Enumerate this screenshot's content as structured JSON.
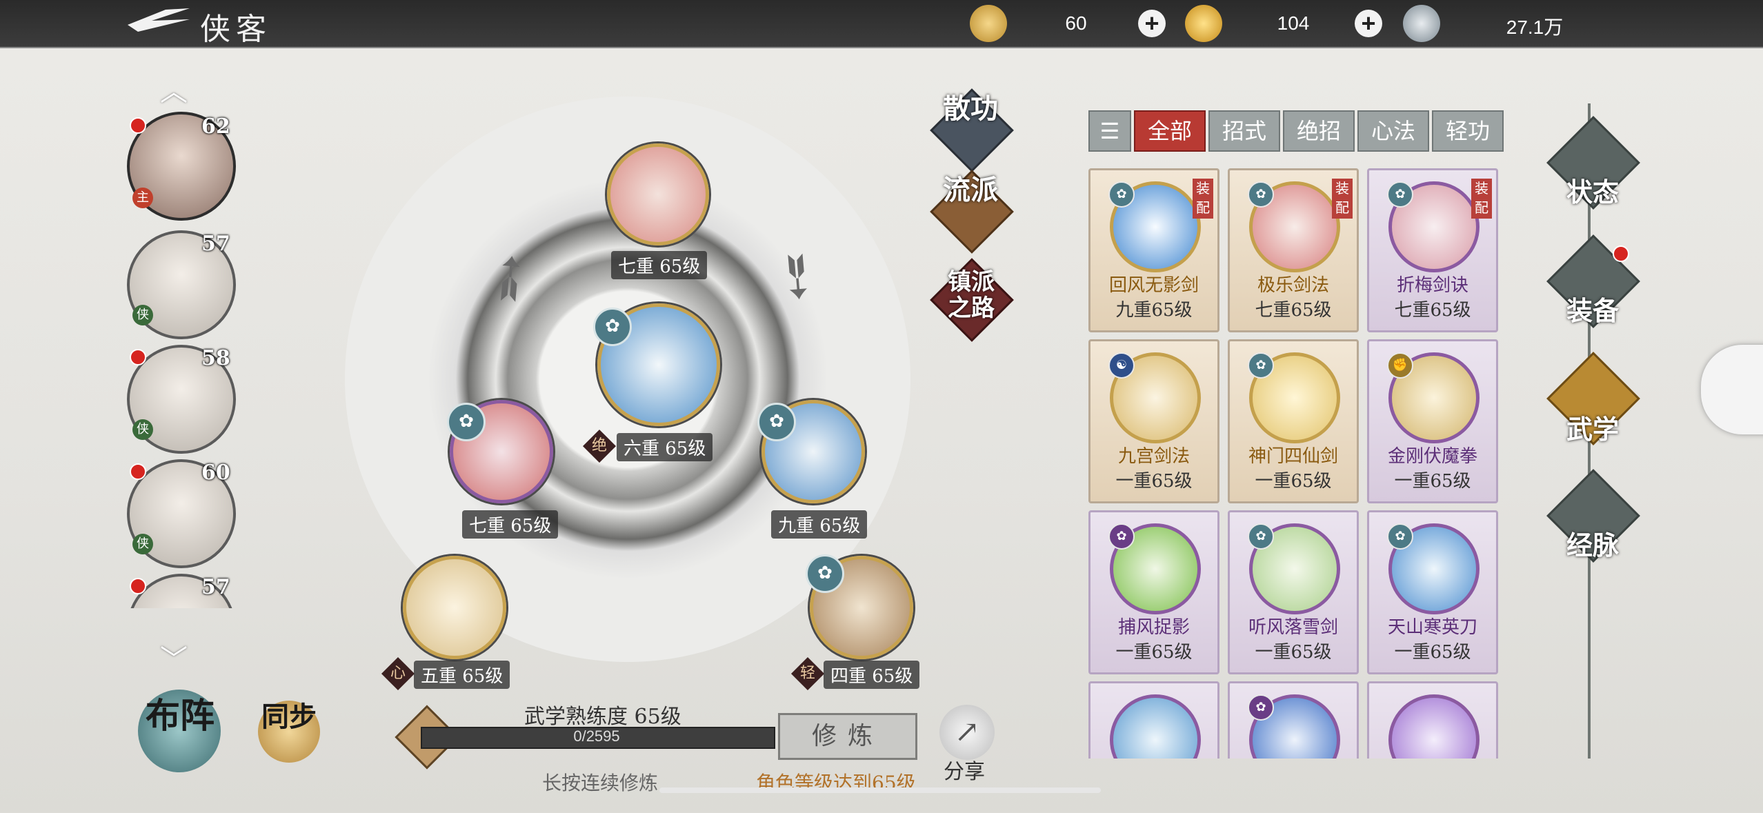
{
  "header": {
    "title": "侠客",
    "resources": [
      {
        "icon": "gold-leaf-icon",
        "value": "60"
      },
      {
        "icon": "gold-ingot-icon",
        "value": "104"
      },
      {
        "icon": "copper-coin-icon",
        "value": "27.1万"
      }
    ]
  },
  "characters": [
    {
      "level": "62",
      "tag": "主",
      "red_dot": true,
      "active": true
    },
    {
      "level": "57",
      "tag": "侠",
      "red_dot": false
    },
    {
      "level": "58",
      "tag": "侠",
      "red_dot": true
    },
    {
      "level": "60",
      "tag": "侠",
      "red_dot": true
    },
    {
      "level": "57",
      "tag": "",
      "red_dot": true
    }
  ],
  "wheel": {
    "center": {
      "label": "六重 65级",
      "badge": "绝"
    },
    "top": {
      "label": "七重 65级"
    },
    "left": {
      "label": "七重 65级"
    },
    "right": {
      "label": "九重 65级"
    },
    "bottom_left": {
      "label": "五重 65级",
      "badge": "心"
    },
    "bottom_right": {
      "label": "四重 65级",
      "badge": "轻"
    }
  },
  "side_buttons": [
    "散功",
    "流派",
    "镇派之路"
  ],
  "filter_tabs": [
    "全部",
    "招式",
    "绝招",
    "心法",
    "轻功"
  ],
  "skills": [
    {
      "name": "回风无影剑",
      "level": "九重65级",
      "equipped": "装配",
      "rarity": "gold"
    },
    {
      "name": "极乐剑法",
      "level": "七重65级",
      "equipped": "装配",
      "rarity": "gold"
    },
    {
      "name": "折梅剑诀",
      "level": "七重65级",
      "equipped": "装配",
      "rarity": "purple"
    },
    {
      "name": "九宫剑法",
      "level": "一重65级",
      "equipped": "",
      "rarity": "gold"
    },
    {
      "name": "神门四仙剑",
      "level": "一重65级",
      "equipped": "",
      "rarity": "gold"
    },
    {
      "name": "金刚伏魔拳",
      "level": "一重65级",
      "equipped": "",
      "rarity": "purple"
    },
    {
      "name": "捕风捉影",
      "level": "一重65级",
      "equipped": "",
      "rarity": "purple"
    },
    {
      "name": "听风落雪剑",
      "level": "一重65级",
      "equipped": "",
      "rarity": "purple"
    },
    {
      "name": "天山寒英刀",
      "level": "一重65级",
      "equipped": "",
      "rarity": "purple"
    },
    {
      "name": "",
      "level": "",
      "equipped": "",
      "rarity": "purple"
    },
    {
      "name": "",
      "level": "",
      "equipped": "",
      "rarity": "purple"
    },
    {
      "name": "",
      "level": "",
      "equipped": "",
      "rarity": "purple"
    }
  ],
  "right_nav": [
    "状态",
    "装备",
    "武学",
    "经脉"
  ],
  "bottom": {
    "formation": "布阵",
    "sync": "同步",
    "proficiency_label": "武学熟练度 65级",
    "progress_text": "0/2595",
    "progress_fraction": 0,
    "train_button": "修炼",
    "hold_hint": "长按连续修炼",
    "level_hint": "角色等级达到65级",
    "share": "分享"
  }
}
